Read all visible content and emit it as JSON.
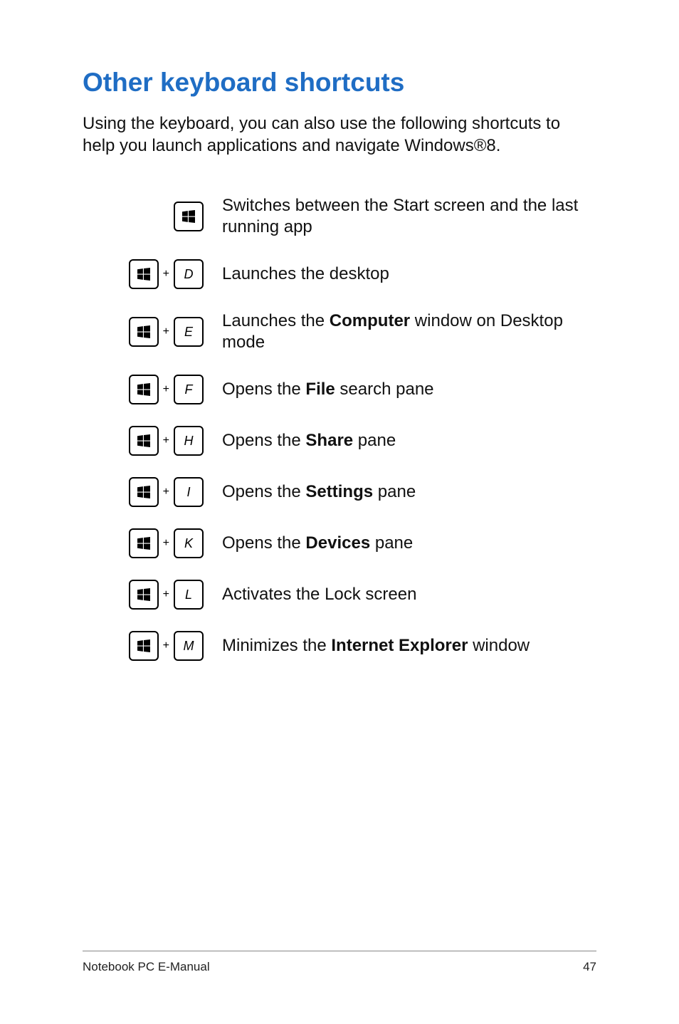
{
  "title": "Other keyboard shortcuts",
  "intro": "Using the keyboard, you can also use the following shortcuts to help you launch applications and navigate Windows®8.",
  "plus": "+",
  "shortcuts": [
    {
      "combo": [
        "win"
      ],
      "desc_html": "Switches between the Start screen and the last running app"
    },
    {
      "combo": [
        "win",
        "D"
      ],
      "desc_html": "Launches the desktop"
    },
    {
      "combo": [
        "win",
        "E"
      ],
      "desc_html": "Launches the <b>Computer</b> window on Desktop mode"
    },
    {
      "combo": [
        "win",
        "F"
      ],
      "desc_html": "Opens the <b>File</b> search pane"
    },
    {
      "combo": [
        "win",
        "H"
      ],
      "desc_html": "Opens the <b>Share</b> pane"
    },
    {
      "combo": [
        "win",
        "I"
      ],
      "desc_html": "Opens the <b>Settings</b> pane"
    },
    {
      "combo": [
        "win",
        "K"
      ],
      "desc_html": "Opens the <b>Devices</b> pane"
    },
    {
      "combo": [
        "win",
        "L"
      ],
      "desc_html": "Activates the Lock screen"
    },
    {
      "combo": [
        "win",
        "M"
      ],
      "desc_html": "Minimizes the <b>Internet Explorer</b> window"
    }
  ],
  "footer": {
    "left": "Notebook PC E-Manual",
    "right": "47"
  }
}
